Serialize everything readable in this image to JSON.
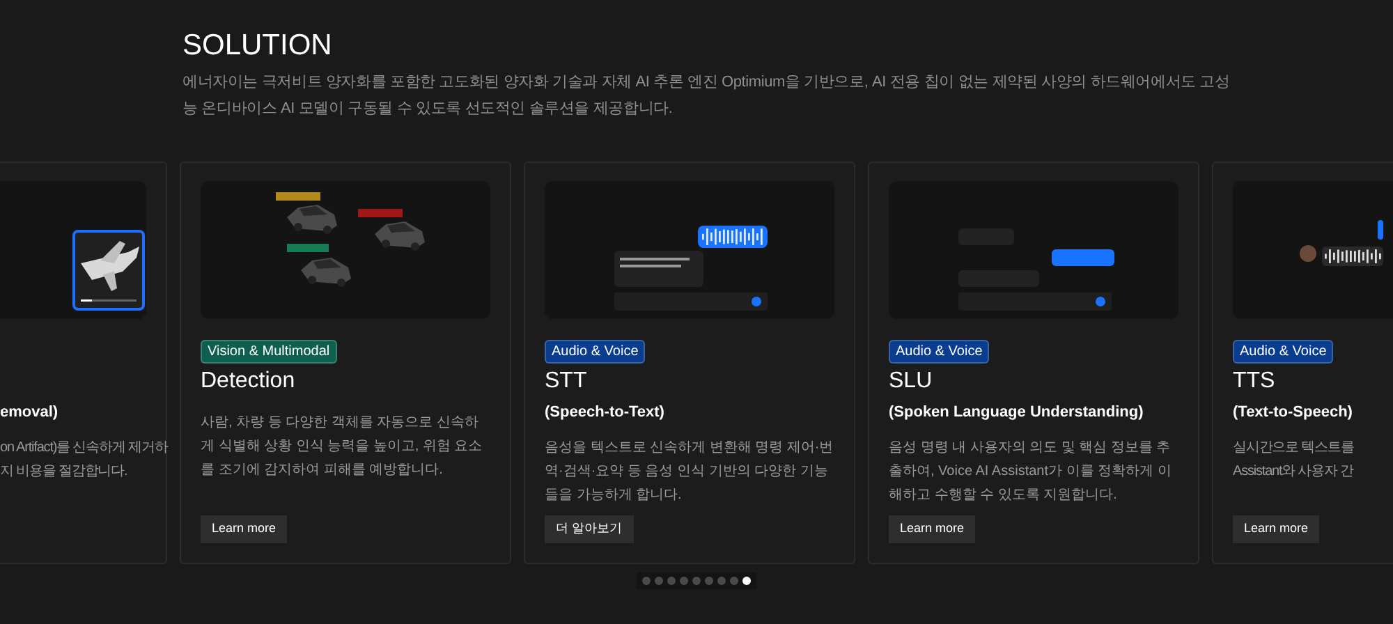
{
  "heading": "SOLUTION",
  "intro": "에너자이는 극저비트 양자화를 포함한 고도화된 양자화 기술과 자체 AI 추론 엔진 Optimium을 기반으로, AI 전용 칩이 없는 제약된 사양의  하드웨어에서도 고성능 온디바이스 AI 모델이 구동될 수 있도록 선도적인 솔루션을 제공합니다.",
  "cards": [
    {
      "kind": "airplane",
      "subtitle": "emoval)",
      "description": [
        "on Artifact)를 신속하게 제거하",
        "지 비용을 절감합니다."
      ]
    },
    {
      "kind": "detection",
      "tag": {
        "label": "Vision & Multimodal",
        "color": "#0f5f50"
      },
      "title": "Detection",
      "description": [
        "사람, 차량 등 다양한 객체를 자동으로 신속하게 식별해 상황 인식 능력을 높이고, 위험 요소를 조기에 감지하여 피해를 예방합니다."
      ],
      "button": "Learn more"
    },
    {
      "kind": "stt",
      "tag": {
        "label": "Audio & Voice",
        "color": "#0b3d8f"
      },
      "title": "STT",
      "subtitle": "(Speech-to-Text)",
      "description": [
        "음성을 텍스트로 신속하게 변환해 명령 제어·번역·검색·요약 등 음성 인식 기반의 다양한 기능들을 가능하게 합니다."
      ],
      "button": "더 알아보기"
    },
    {
      "kind": "slu",
      "tag": {
        "label": "Audio & Voice",
        "color": "#0b3d8f"
      },
      "title": "SLU",
      "subtitle": "(Spoken Language Understanding)",
      "description": [
        "음성 명령 내 사용자의 의도 및 핵심 정보를 추출하여, Voice AI Assistant가 이를 정확하게 이해하고 수행할 수 있도록 지원합니다."
      ],
      "button": "Learn more"
    },
    {
      "kind": "tts",
      "tag": {
        "label": "Audio & Voice",
        "color": "#0b3d8f"
      },
      "title": "TTS",
      "subtitle": "(Text-to-Speech)",
      "description": [
        "실시간으로 텍스트를",
        "Assistant와 사용자 간"
      ],
      "button": "Learn more"
    }
  ],
  "pagination": [
    {
      "selected": false
    },
    {
      "selected": false
    },
    {
      "selected": false
    },
    {
      "selected": false
    },
    {
      "selected": false
    },
    {
      "selected": false
    },
    {
      "selected": false
    },
    {
      "selected": false
    },
    {
      "selected": true
    }
  ]
}
